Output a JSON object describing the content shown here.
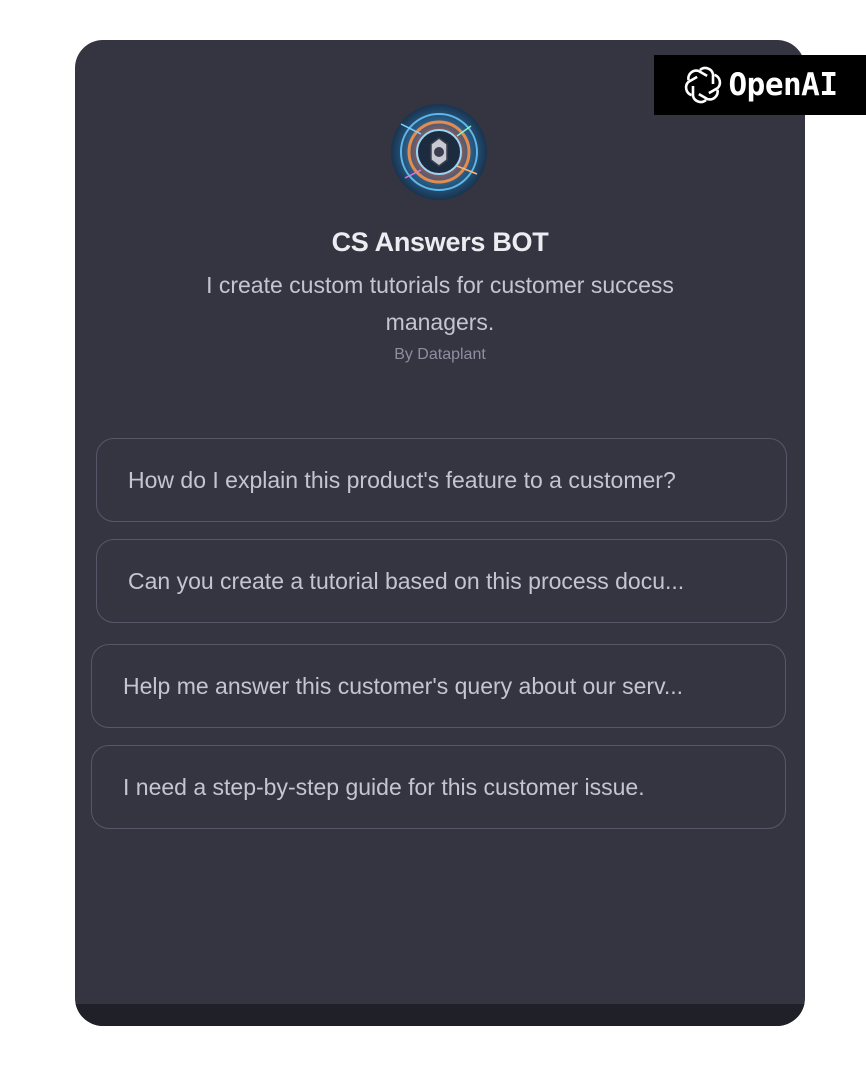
{
  "brand": {
    "name": "OpenAI",
    "logo_icon": "openai-logo-icon"
  },
  "gpt": {
    "avatar_icon": "bot-avatar-icon",
    "title": "CS Answers BOT",
    "description": "I create custom tutorials for customer success managers.",
    "author": "By Dataplant"
  },
  "conversation_starters": [
    {
      "label": "How do I explain this product's feature to a customer?"
    },
    {
      "label": "Can you create a tutorial based on this process docu..."
    },
    {
      "label": "Help me answer this customer's query about our serv..."
    },
    {
      "label": "I need a step-by-step guide for this customer issue."
    }
  ],
  "colors": {
    "card_background": "#343541",
    "border": "#565869",
    "text_primary": "#ececf1",
    "text_secondary": "#c5c5d2",
    "text_muted": "#8e8ea0",
    "badge_background": "#000000"
  }
}
